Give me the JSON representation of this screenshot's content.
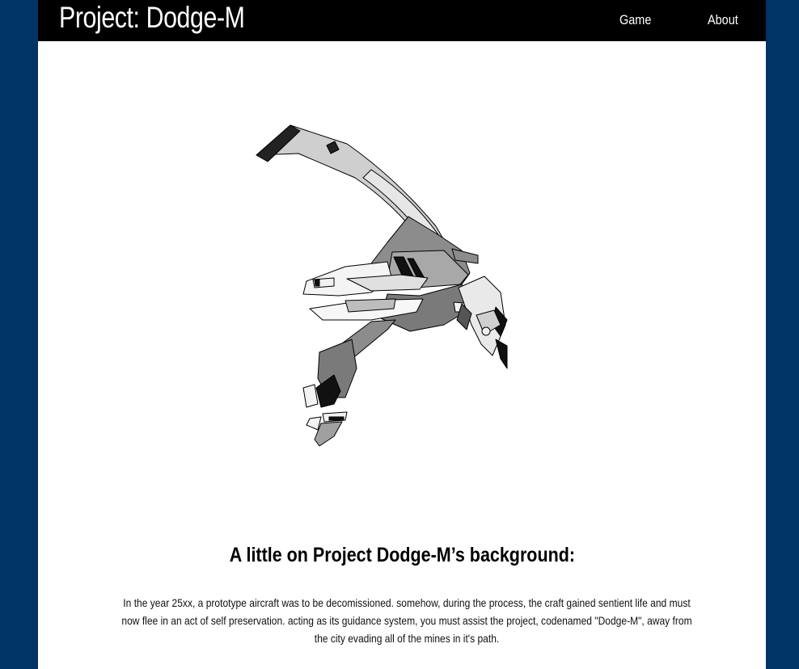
{
  "header": {
    "title": "Project: Dodge-M",
    "nav": {
      "game_label": "Game",
      "about_label": "About"
    }
  },
  "hero": {
    "image_icon": "aircraft-illustration"
  },
  "main": {
    "heading": "A little on Project Dodge-M’s background:",
    "paragraph": "In the year 25xx, a prototype aircraft was to be decomissioned. somehow, during the process, the craft gained sentient life and must now flee in an act of self preservation. acting as its guidance system, you must assist the project, codenamed \"Dodge-M\", away from the city evading all of the mines in it's path."
  },
  "colors": {
    "background": "#003366",
    "header_bg": "#000000",
    "page_bg": "#ffffff"
  }
}
